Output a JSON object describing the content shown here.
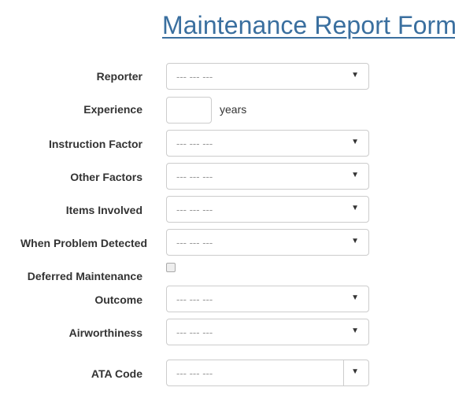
{
  "page": {
    "title": "Maintenance Report Form"
  },
  "form": {
    "reporter": {
      "label": "Reporter",
      "value": "--- --- ---"
    },
    "experience": {
      "label": "Experience",
      "value": "",
      "unit": "years"
    },
    "instruction_factor": {
      "label": "Instruction Factor",
      "value": "--- --- ---"
    },
    "other_factors": {
      "label": "Other Factors",
      "value": "--- --- ---"
    },
    "items_involved": {
      "label": "Items Involved",
      "value": "--- --- ---"
    },
    "when_problem_detected": {
      "label": "When Problem Detected",
      "value": "--- --- ---"
    },
    "deferred_maintenance": {
      "label": "Deferred Maintenance",
      "checked": false
    },
    "outcome": {
      "label": "Outcome",
      "value": "--- --- ---"
    },
    "airworthiness": {
      "label": "Airworthiness",
      "value": "--- --- ---"
    },
    "ata_code": {
      "label": "ATA Code",
      "value": "--- --- ---"
    },
    "caret_glyph": "▼"
  }
}
